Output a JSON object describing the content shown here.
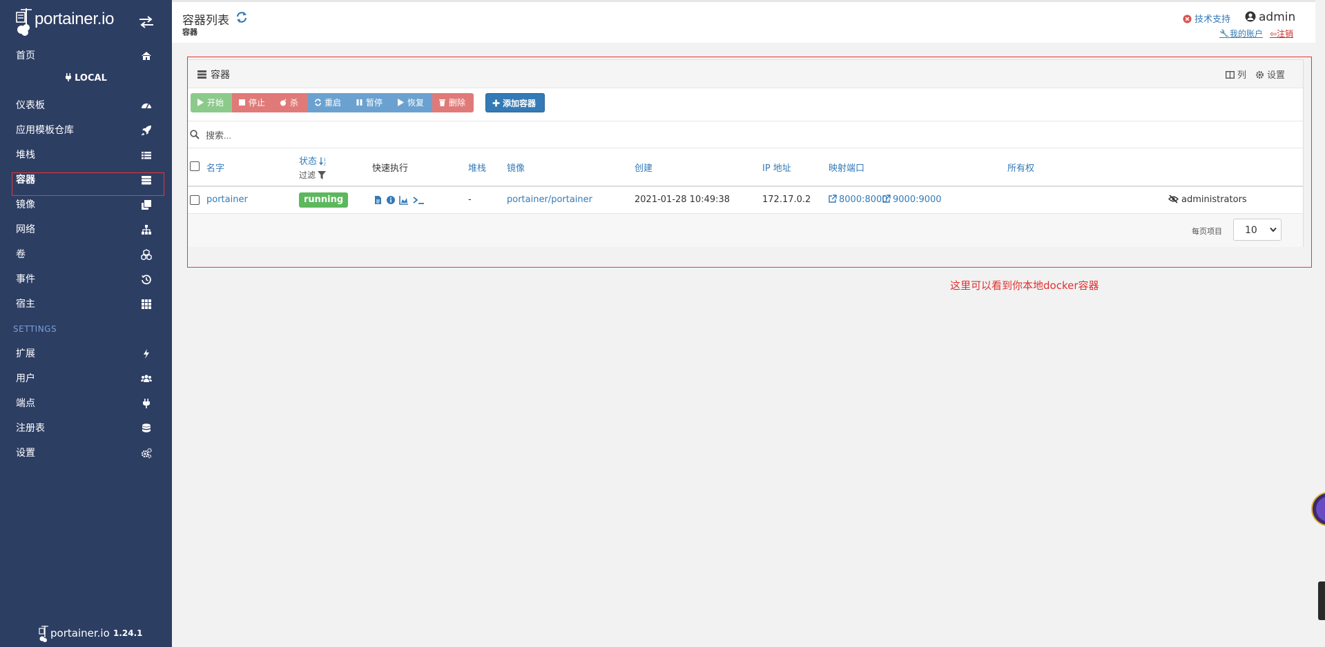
{
  "brand": {
    "name": "portainer.io",
    "version": "1.24.1"
  },
  "sidebar": {
    "endpoint": "LOCAL",
    "settings_section": "SETTINGS",
    "items": [
      {
        "label": "首页",
        "icon": "home-icon"
      },
      {
        "label": "仪表板",
        "icon": "dashboard-icon"
      },
      {
        "label": "应用模板仓库",
        "icon": "rocket-icon"
      },
      {
        "label": "堆栈",
        "icon": "list-icon"
      },
      {
        "label": "容器",
        "icon": "server-icon"
      },
      {
        "label": "镜像",
        "icon": "clone-icon"
      },
      {
        "label": "网络",
        "icon": "sitemap-icon"
      },
      {
        "label": "卷",
        "icon": "cubes-icon"
      },
      {
        "label": "事件",
        "icon": "history-icon"
      },
      {
        "label": "宿主",
        "icon": "grid-icon"
      },
      {
        "label": "扩展",
        "icon": "bolt-icon"
      },
      {
        "label": "用户",
        "icon": "users-icon"
      },
      {
        "label": "端点",
        "icon": "plug-icon"
      },
      {
        "label": "注册表",
        "icon": "database-icon"
      },
      {
        "label": "设置",
        "icon": "cogs-icon"
      }
    ],
    "active_index": 4
  },
  "header": {
    "title": "容器列表",
    "breadcrumb": "容器",
    "help_label": "技术支持",
    "user": "admin",
    "account_label": "我的账户",
    "logout_label": "注销"
  },
  "widget": {
    "title": "容器",
    "columns_label": "列",
    "settings_label": "设置",
    "actions": {
      "start": "开始",
      "stop": "停止",
      "kill": "杀",
      "restart": "重启",
      "pause": "暂停",
      "resume": "恢复",
      "remove": "删除",
      "add": "添加容器"
    },
    "search_placeholder": "搜索...",
    "columns": {
      "name": "名字",
      "state": "状态",
      "filter": "过滤",
      "quick_actions": "快速执行",
      "stack": "堆栈",
      "image": "镜像",
      "created": "创建",
      "ip": "IP 地址",
      "ports": "映射端口",
      "ownership": "所有权"
    },
    "rows": [
      {
        "name": "portainer",
        "state": "running",
        "stack": "-",
        "image": "portainer/portainer",
        "created": "2021-01-28 10:49:38",
        "ip": "172.17.0.2",
        "ports": [
          "8000:8000",
          "9000:9000"
        ],
        "ownership": "administrators"
      }
    ],
    "per_page_label": "每页项目",
    "per_page_value": "10"
  },
  "annotation": "这里可以看到你本地docker容器",
  "colors": {
    "sidebar_bg": "#2d3e63",
    "link": "#337ab7",
    "running": "#5cb85c",
    "danger": "#e07a78",
    "annotation": "#e03030"
  }
}
